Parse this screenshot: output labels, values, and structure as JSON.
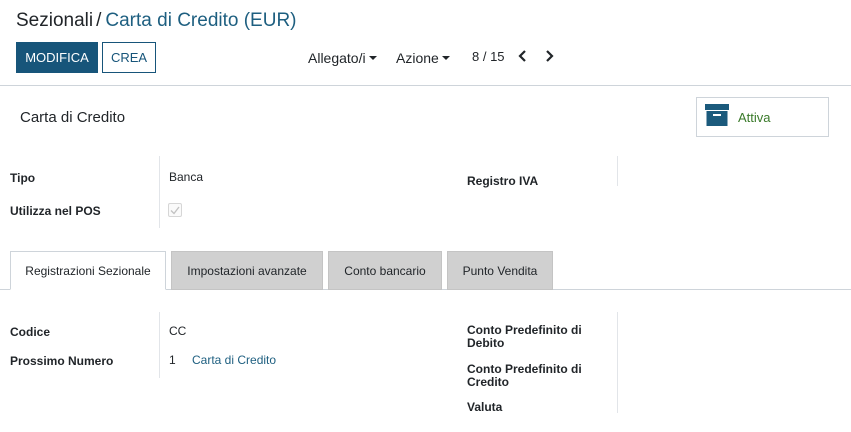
{
  "breadcrumb": {
    "root": "Sezionali",
    "separator": "/",
    "current": "Carta di Credito (EUR)"
  },
  "buttons": {
    "edit": "MODIFICA",
    "create": "CREA"
  },
  "dropdowns": {
    "attachments": "Allegato/i",
    "action": "Azione"
  },
  "pager": {
    "value": "8 / 15"
  },
  "sheet": {
    "title": "Carta di Credito"
  },
  "stat_button": {
    "label": "Attiva",
    "icon": "archive-icon"
  },
  "fields": {
    "tipo": {
      "label": "Tipo",
      "value": "Banca"
    },
    "pos": {
      "label": "Utilizza nel POS",
      "checked": true
    },
    "registro_iva": {
      "label": "Registro IVA",
      "value": ""
    }
  },
  "tabs": [
    {
      "label": "Registrazioni Sezionale",
      "active": true
    },
    {
      "label": "Impostazioni avanzate",
      "active": false
    },
    {
      "label": "Conto bancario",
      "active": false
    },
    {
      "label": "Punto Vendita",
      "active": false
    }
  ],
  "tab_fields": {
    "codice": {
      "label": "Codice",
      "value": "CC"
    },
    "prossimo_numero": {
      "label": "Prossimo Numero",
      "value": "1",
      "link": "Carta di Credito"
    },
    "conto_debito": {
      "label_line1": "Conto Predefinito di",
      "label_line2": "Debito"
    },
    "conto_credito": {
      "label_line1": "Conto Predefinito di",
      "label_line2": "Credito"
    },
    "valuta": {
      "label": "Valuta"
    }
  },
  "colors": {
    "primary": "#17557a",
    "link": "#1e5f80",
    "active_green": "#3a7a2a"
  }
}
